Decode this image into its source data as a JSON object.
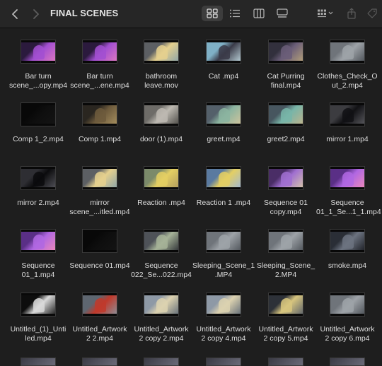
{
  "window": {
    "title": "FINAL SCENES"
  },
  "toolbar": {
    "back_icon": "chevron-left-icon",
    "forward_icon": "chevron-right-icon",
    "views": [
      {
        "name": "icon-view-button",
        "icon": "grid-icon",
        "active": true
      },
      {
        "name": "list-view-button",
        "icon": "list-icon",
        "active": false
      },
      {
        "name": "column-view-button",
        "icon": "columns-icon",
        "active": false
      },
      {
        "name": "gallery-view-button",
        "icon": "gallery-icon",
        "active": false
      }
    ],
    "group_icon": "group-by-icon",
    "share_icon": "share-icon",
    "tag_icon": "tag-icon"
  },
  "files": [
    {
      "label": "Bar turn\nscene_...opy.mp4",
      "thumb": "purple-scene"
    },
    {
      "label": "Bar turn\nscene_...ene.mp4",
      "thumb": "purple-scene"
    },
    {
      "label": "bathroom\nleave.mov",
      "thumb": "character-blond"
    },
    {
      "label": "Cat .mp4",
      "thumb": "cat-scene"
    },
    {
      "label": "Cat Purring\nfinal.mp4",
      "thumb": "cat-dark"
    },
    {
      "label": "Clothes_Check_O\nut_2.mp4",
      "thumb": "gray-room"
    },
    {
      "label": "Comp 1_2.mp4",
      "thumb": "black"
    },
    {
      "label": "Comp 1.mp4",
      "thumb": "dark-room"
    },
    {
      "label": "door (1).mp4",
      "thumb": "door"
    },
    {
      "label": "greet.mp4",
      "thumb": "character-green"
    },
    {
      "label": "greet2.mp4",
      "thumb": "character-teal"
    },
    {
      "label": "mirror 1.mp4",
      "thumb": "silhouette"
    },
    {
      "label": "mirror 2.mp4",
      "thumb": "black-cat"
    },
    {
      "label": "mirror\nscene_...itled.mp4",
      "thumb": "character-blond"
    },
    {
      "label": "Reaction .mp4",
      "thumb": "character-yellow"
    },
    {
      "label": "Reaction 1 .mp4",
      "thumb": "character-yellow-blue"
    },
    {
      "label": "Sequence 01\ncopy.mp4",
      "thumb": "purple-figure"
    },
    {
      "label": "Sequence\n01_1_Se...1_1.mp4",
      "thumb": "purple-hands"
    },
    {
      "label": "Sequence\n01_1.mp4",
      "thumb": "purple-hands"
    },
    {
      "label": "Sequence 01.mp4",
      "thumb": "black"
    },
    {
      "label": "Sequence\n022_Se...022.mp4",
      "thumb": "two-figures"
    },
    {
      "label": "Sleeping_Scene_1\n.MP4",
      "thumb": "gray-room"
    },
    {
      "label": "Sleeping_Scene_\n2.MP4",
      "thumb": "gray-room"
    },
    {
      "label": "smoke.mp4",
      "thumb": "smoke"
    },
    {
      "label": "Untitled_(1)_Unti\nled.mp4",
      "thumb": "title-card"
    },
    {
      "label": "Untitled_Artwork\n2 2.mp4",
      "thumb": "red-shoes"
    },
    {
      "label": "Untitled_Artwork\n2 copy 2.mp4",
      "thumb": "sleeping"
    },
    {
      "label": "Untitled_Artwork\n2 copy 4.mp4",
      "thumb": "sleeping"
    },
    {
      "label": "Untitled_Artwork\n2 copy 5.mp4",
      "thumb": "character-dark"
    },
    {
      "label": "Untitled_Artwork\n2 copy 6.mp4",
      "thumb": "gray-room"
    }
  ],
  "thumb_palettes": {
    "purple-scene": [
      "#2b1a3d",
      "#a24fd1",
      "#e07ac0"
    ],
    "character-blond": [
      "#5c5f63",
      "#e5d08e",
      "#8aa2a8"
    ],
    "cat-scene": [
      "#7fb0c6",
      "#3a3a48",
      "#bfd7de"
    ],
    "cat-dark": [
      "#32303d",
      "#6a5d78",
      "#b6a27a"
    ],
    "gray-room": [
      "#6f747a",
      "#9ea3a8",
      "#4c5157"
    ],
    "black": [
      "#080808",
      "#0e0e0e",
      "#141414"
    ],
    "dark-room": [
      "#2a2620",
      "#6d5a3c",
      "#a89160"
    ],
    "door": [
      "#6e6c68",
      "#bdb9b1",
      "#4a4844"
    ],
    "character-green": [
      "#54606a",
      "#8bb4a0",
      "#d3c59c"
    ],
    "character-teal": [
      "#47565f",
      "#78b5a8",
      "#c1b38b"
    ],
    "silhouette": [
      "#3c3c40",
      "#111114",
      "#5a5a60"
    ],
    "black-cat": [
      "#2e2e33",
      "#0b0b0d",
      "#55555c"
    ],
    "character-yellow": [
      "#7b8a6a",
      "#e4cf63",
      "#b09b5e"
    ],
    "character-yellow-blue": [
      "#5a7aa0",
      "#e4cf63",
      "#9fb8d8"
    ],
    "purple-figure": [
      "#4a2d66",
      "#a06fd0",
      "#d8c8a8"
    ],
    "purple-hands": [
      "#5a2f86",
      "#b067e2",
      "#f08ab8"
    ],
    "two-figures": [
      "#4e5258",
      "#a6b398",
      "#2b2e33"
    ],
    "smoke": [
      "#2a2e36",
      "#6c7380",
      "#1a1c22"
    ],
    "title-card": [
      "#0d0d0d",
      "#d9d9d9",
      "#1a1a1a"
    ],
    "red-shoes": [
      "#5e6670",
      "#c0392b",
      "#8a929c"
    ],
    "sleeping": [
      "#8e99a6",
      "#dcd2b0",
      "#5f6a76"
    ],
    "character-dark": [
      "#2d3138",
      "#d7c57e",
      "#5a616b"
    ]
  }
}
